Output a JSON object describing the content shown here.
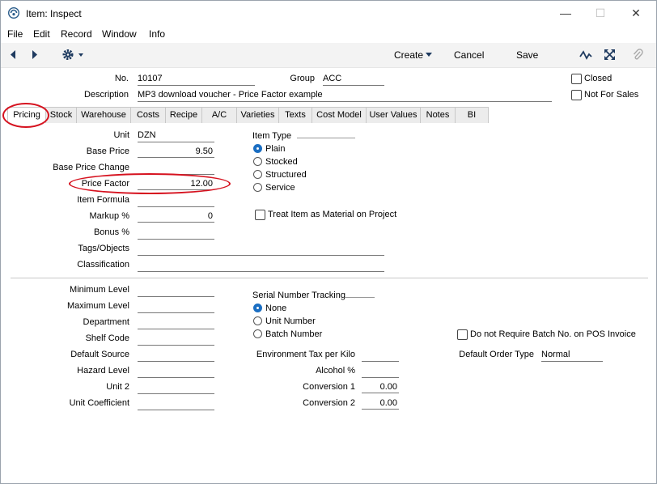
{
  "window": {
    "title": "Item: Inspect"
  },
  "menu": [
    "File",
    "Edit",
    "Record",
    "Window",
    "Info"
  ],
  "toolbar": {
    "create": "Create",
    "cancel": "Cancel",
    "save": "Save"
  },
  "header": {
    "no_label": "No.",
    "no_value": "10107",
    "group_label": "Group",
    "group_value": "ACC",
    "description_label": "Description",
    "description_value": "MP3 download voucher - Price Factor example",
    "closed_label": "Closed",
    "not_for_sales_label": "Not For Sales"
  },
  "tabs": [
    "Pricing",
    "Stock",
    "Warehouse",
    "Costs",
    "Recipe",
    "A/C",
    "Varieties",
    "Texts",
    "Cost Model",
    "User Values",
    "Notes",
    "BI"
  ],
  "pricing": {
    "unit_label": "Unit",
    "unit_value": "DZN",
    "base_price_label": "Base Price",
    "base_price_value": "9.50",
    "base_price_change_label": "Base Price Change",
    "price_factor_label": "Price Factor",
    "price_factor_value": "12.00",
    "item_formula_label": "Item Formula",
    "markup_label": "Markup %",
    "markup_value": "0",
    "bonus_label": "Bonus %",
    "tags_label": "Tags/Objects",
    "classification_label": "Classification",
    "item_type_label": "Item Type",
    "item_types": [
      "Plain",
      "Stocked",
      "Structured",
      "Service"
    ],
    "treat_label": "Treat Item as Material on Project"
  },
  "lower": {
    "minimum_level_label": "Minimum Level",
    "maximum_level_label": "Maximum Level",
    "department_label": "Department",
    "shelf_code_label": "Shelf Code",
    "default_source_label": "Default Source",
    "hazard_level_label": "Hazard Level",
    "unit2_label": "Unit 2",
    "unit_coefficient_label": "Unit Coefficient",
    "serial_label": "Serial Number Tracking",
    "serial_options": [
      "None",
      "Unit Number",
      "Batch Number"
    ],
    "env_tax_label": "Environment Tax per Kilo",
    "alcohol_label": "Alcohol %",
    "conversion1_label": "Conversion 1",
    "conversion1_value": "0.00",
    "conversion2_label": "Conversion 2",
    "conversion2_value": "0.00",
    "no_batch_label": "Do not Require Batch No. on POS Invoice",
    "default_order_type_label": "Default Order Type",
    "default_order_type_value": "Normal"
  },
  "colors": {
    "accent": "#1b6ec2",
    "highlight_oval": "#d6121f"
  }
}
